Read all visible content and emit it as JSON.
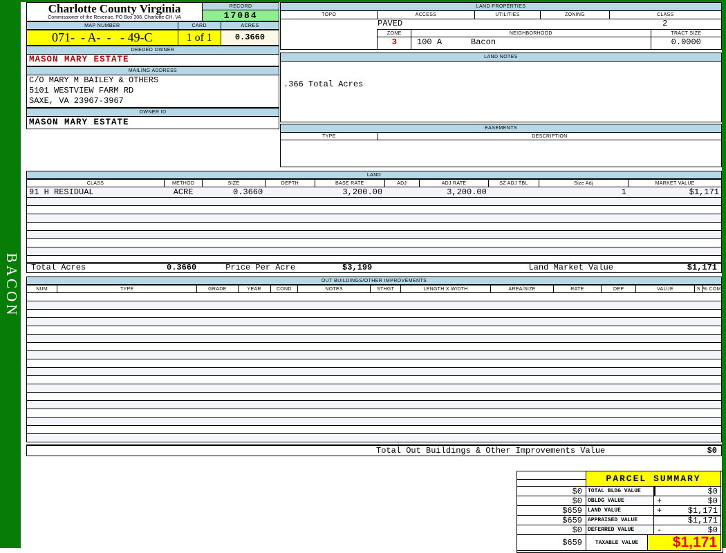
{
  "app": {
    "county": "Charlotte County Virginia",
    "commissioner_line": "Commissioner of the Revenue, PO  Box 308, Charlotte CH, VA",
    "sidebar_label": "BACON"
  },
  "header": {
    "record_label": "RECORD",
    "record_value": "17084",
    "map_number_label": "MAP NUMBER",
    "map_number_value": "071-  - A-  -   - 49-C",
    "card_label": "CARD",
    "card_value": "1 of 1",
    "acres_label": "ACRES",
    "acres_value": "0.3660"
  },
  "owner": {
    "deeded_owner_label": "DEEDED OWNER",
    "deeded_owner": "MASON MARY ESTATE",
    "mailing_address_label": "MAILING ADDRESS",
    "address_line1": "C/O MARY M BAILEY & OTHERS",
    "address_line2": "5101 WESTVIEW FARM RD",
    "address_line3": "SAXE, VA 23967-3967",
    "owner_id_label": "OWNER ID",
    "owner_id": "MASON MARY ESTATE"
  },
  "land_properties": {
    "title": "LAND PROPERTIES",
    "columns": [
      "TOPO",
      "ACCESS",
      "UTILITIES",
      "ZONING",
      "CLASS"
    ],
    "topo": "",
    "access": "PAVED",
    "utilities": "",
    "zoning": "",
    "class": "2",
    "zone_label": "ZONE",
    "zone": "3",
    "neighborhood_label": "NEIGHBORHOOD",
    "neighborhood_code": "100 A",
    "neighborhood_name": "Bacon",
    "tract_size_label": "TRACT SIZE",
    "tract_size": "0.0000"
  },
  "land_notes": {
    "title": "LAND NOTES",
    "note": ".366 Total Acres"
  },
  "easements": {
    "title": "EASEMENTS",
    "columns": [
      "TYPE",
      "DESCRIPTION"
    ]
  },
  "land": {
    "title": "LAND",
    "columns": [
      "CLASS",
      "METHOD",
      "SIZE",
      "DEPTH",
      "BASE RATE",
      "ADJ",
      "ADJ RATE",
      "SZ ADJ TBL",
      "Size Adj",
      "MARKET VALUE"
    ],
    "rows": [
      [
        "91 H RESIDUAL",
        "ACRE",
        "0.3660",
        "",
        "3,200.00",
        "",
        "3,200.00",
        "",
        "1",
        "$1,171"
      ]
    ],
    "empty_row_count": 8,
    "totals": {
      "total_acres_label": "Total Acres",
      "total_acres": "0.3660",
      "price_per_acre_label": "Price Per Acre",
      "price_per_acre": "$3,199",
      "land_market_value_label": "Land Market Value",
      "land_market_value": "$1,171"
    }
  },
  "out_buildings": {
    "title": "OUT BUILDINGS/OTHER IMPROVEMENTS",
    "columns": [
      "NUM",
      "TYPE",
      "GRADE",
      "YEAR",
      "COND",
      "NOTES",
      "STHGT",
      "LENGTH X WIDTH",
      "AREA/SIZE",
      "RATE",
      "DEP",
      "VALUE",
      "S",
      "% COMP"
    ],
    "empty_row_count": 18,
    "total_label": "Total Out Buildings & Other Improvements Value",
    "total_value": "$0"
  },
  "parcel_summary": {
    "title": "PARCEL SUMMARY",
    "rows": [
      {
        "prev": "$0",
        "label": "TOTAL BLDG VALUE",
        "op": "",
        "value": "$0"
      },
      {
        "prev": "$0",
        "label": "OBLDG VALUE",
        "op": "+",
        "value": "$0"
      },
      {
        "prev": "$659",
        "label": "LAND VALUE",
        "op": "+",
        "value": "$1,171"
      },
      {
        "prev": "$659",
        "label": "APPRAISED VALUE",
        "op": "",
        "value": "$1,171"
      },
      {
        "prev": "$0",
        "label": "DEFERRED VALUE",
        "op": "-",
        "value": "$0"
      }
    ],
    "taxable": {
      "prev": "$659",
      "label": "TAXABLE VALUE",
      "value": "$1,171"
    }
  },
  "colors": {
    "frame_green": "#077d07",
    "header_blue": "#b6d8e6",
    "record_green": "#90ee90",
    "highlight_yellow": "#ffff00",
    "acres_cream": "#fcfae6",
    "owner_red": "#c00000",
    "taxable_red": "#ff0000"
  }
}
